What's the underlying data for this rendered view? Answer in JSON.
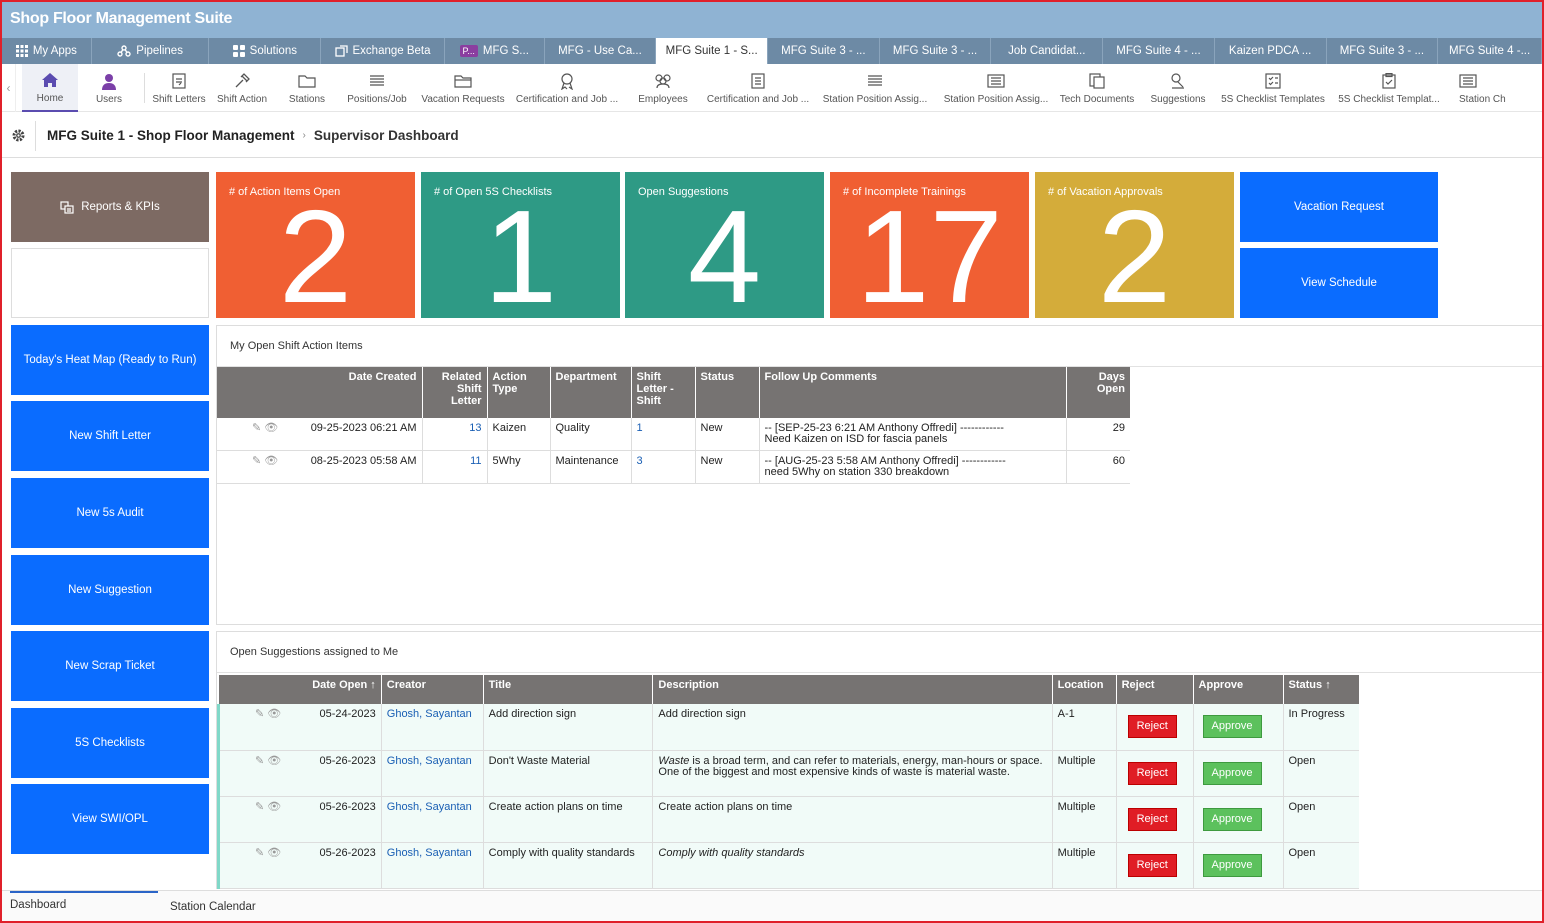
{
  "app": {
    "title": "Shop Floor Management Suite"
  },
  "topnav": [
    {
      "label": "My Apps",
      "icon": "grid-icon"
    },
    {
      "label": "Pipelines",
      "icon": "pipeline-icon"
    },
    {
      "label": "Solutions",
      "icon": "solutions-icon"
    },
    {
      "label": "Exchange Beta",
      "icon": "exchange-icon"
    },
    {
      "label": "MFG S...",
      "badge": "P..."
    },
    {
      "label": "MFG - Use Ca..."
    },
    {
      "label": "MFG Suite 1 - S...",
      "active": true
    },
    {
      "label": "MFG Suite 3 - ..."
    },
    {
      "label": "MFG Suite 3 - ..."
    },
    {
      "label": "Job Candidat..."
    },
    {
      "label": "MFG Suite 4 - ..."
    },
    {
      "label": "Kaizen PDCA ..."
    },
    {
      "label": "MFG Suite 3 - ..."
    },
    {
      "label": "MFG Suite 4 -..."
    }
  ],
  "ribbon": [
    {
      "label": "Home"
    },
    {
      "label": "Users"
    },
    {
      "label": "Shift Letters"
    },
    {
      "label": "Shift Action"
    },
    {
      "label": "Stations"
    },
    {
      "label": "Positions/Job"
    },
    {
      "label": "Vacation Requests"
    },
    {
      "label": "Certification and Job ..."
    },
    {
      "label": "Employees"
    },
    {
      "label": "Certification and Job ..."
    },
    {
      "label": "Station Position Assig..."
    },
    {
      "label": "Station Position Assig..."
    },
    {
      "label": "Tech Documents"
    },
    {
      "label": "Suggestions"
    },
    {
      "label": "5S Checklist Templates"
    },
    {
      "label": "5S Checklist Templat..."
    },
    {
      "label": "Station Ch"
    }
  ],
  "breadcrumb": {
    "app": "MFG Suite 1 - Shop Floor Management",
    "page": "Supervisor Dashboard"
  },
  "left_buttons": {
    "reports": "Reports & KPIs",
    "heatmap": "Today's Heat Map (Ready to Run)",
    "new_shift_letter": "New Shift Letter",
    "new_5s_audit": "New 5s Audit",
    "new_suggestion": "New Suggestion",
    "new_scrap_ticket": "New Scrap Ticket",
    "checklists": "5S Checklists",
    "view_swi": "View SWI/OPL"
  },
  "kpis": [
    {
      "label": "# of Action Items Open",
      "value": "2",
      "color": "#f05f33"
    },
    {
      "label": "# of Open 5S Checklists",
      "value": "1",
      "color": "#2e9a85"
    },
    {
      "label": "Open Suggestions",
      "value": "4",
      "color": "#2e9a85"
    },
    {
      "label": "# of Incomplete Trainings",
      "value": "17",
      "color": "#f05f33"
    },
    {
      "label": "# of Vacation Approvals",
      "value": "2",
      "color": "#d4ac3a"
    }
  ],
  "right_buttons": {
    "vacation": "Vacation Request",
    "schedule": "View Schedule"
  },
  "shift_actions": {
    "title": "My Open Shift Action Items",
    "headers": [
      "Date Created",
      "Related Shift Letter",
      "Action Type",
      "Department",
      "Shift Letter - Shift",
      "Status",
      "Follow Up Comments",
      "Days Open"
    ],
    "rows": [
      {
        "date": "09-25-2023 06:21 AM",
        "letter": "13",
        "type": "Kaizen",
        "dept": "Quality",
        "shift": "1",
        "status": "New",
        "c1": "-- [SEP-25-23  6:21 AM  Anthony Offredi] ------------",
        "c2": "Need Kaizen on ISD for fascia panels",
        "days": "29"
      },
      {
        "date": "08-25-2023 05:58 AM",
        "letter": "11",
        "type": "5Why",
        "dept": "Maintenance",
        "shift": "3",
        "status": "New",
        "c1": "-- [AUG-25-23  5:58 AM  Anthony Offredi] ------------",
        "c2": "need 5Why on station 330 breakdown",
        "days": "60"
      }
    ]
  },
  "suggestions": {
    "title": "Open Suggestions assigned to Me",
    "headers": [
      "Date Open",
      "Creator",
      "Title",
      "Description",
      "Location",
      "Reject",
      "Approve",
      "Status"
    ],
    "reject_label": "Reject",
    "approve_label": "Approve",
    "rows": [
      {
        "date": "05-24-2023",
        "creator": "Ghosh, Sayantan",
        "title": "Add direction sign",
        "desc_em": "",
        "desc": "Add direction sign",
        "desc2": "",
        "loc": "A-1",
        "status": "In Progress"
      },
      {
        "date": "05-26-2023",
        "creator": "Ghosh, Sayantan",
        "title": "Don't Waste Material",
        "desc_em": "Waste",
        "desc": " is a broad term, and can refer to materials, energy, man-hours or space.",
        "desc2": "One of the biggest and most expensive kinds of waste is material waste.",
        "loc": "Multiple",
        "status": "Open"
      },
      {
        "date": "05-26-2023",
        "creator": "Ghosh, Sayantan",
        "title": "Create action plans on time",
        "desc_em": "",
        "desc": "Create action plans on time",
        "desc2": "",
        "loc": "Multiple",
        "status": "Open"
      },
      {
        "date": "05-26-2023",
        "creator": "Ghosh, Sayantan",
        "title": "Comply with quality standards",
        "desc_em": "Comply with quality standards",
        "desc": "",
        "desc2": "",
        "loc": "Multiple",
        "status": "Open"
      }
    ]
  },
  "bottom_tabs": [
    "Dashboard",
    "Station Calendar"
  ],
  "colors": {
    "titlebar": "#8fb3d3",
    "nav": "#6d8aa5",
    "tile_blue": "#0a6cff",
    "tile_brown": "#7d6a63",
    "header_gray": "#767372"
  }
}
